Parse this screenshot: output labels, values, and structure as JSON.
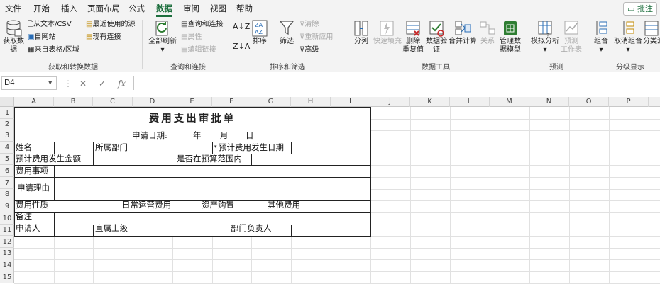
{
  "menu": {
    "tabs": [
      "文件",
      "开始",
      "插入",
      "页面布局",
      "公式",
      "数据",
      "审阅",
      "视图",
      "帮助"
    ],
    "comment_button": "批注"
  },
  "ribbon": {
    "get_transform": {
      "label": "获取和转换数据",
      "get_data": [
        "获取数",
        "据"
      ],
      "from_text_csv": "从文本/CSV",
      "from_web": "自网站",
      "from_table": "来自表格/区域",
      "recent_sources": "最近使用的源",
      "existing_connections": "现有连接"
    },
    "queries": {
      "label": "查询和连接",
      "refresh_all": [
        "全部刷新"
      ],
      "queries_connections": "查询和连接",
      "properties": "属性",
      "edit_links": "编辑链接"
    },
    "sort_filter": {
      "label": "排序和筛选",
      "sort": "排序",
      "filter": "筛选",
      "clear": "清除",
      "reapply": "重新应用",
      "advanced": "高级"
    },
    "data_tools": {
      "label": "数据工具",
      "text_to_columns": "分列",
      "flash_fill": "快速填充",
      "remove_duplicates": [
        "删除",
        "重复值"
      ],
      "data_validation": [
        "数据验",
        "证"
      ],
      "consolidate": "合并计算",
      "relationships": "关系",
      "manage_model": [
        "管理数",
        "据模型"
      ]
    },
    "forecast": {
      "label": "预测",
      "what_if": [
        "模拟分析"
      ],
      "forecast_sheet": [
        "预测",
        "工作表"
      ]
    },
    "outline": {
      "label": "分级显示",
      "group": [
        "组合"
      ],
      "ungroup": [
        "取消组合"
      ],
      "subtotal": "分类汇"
    }
  },
  "formula_bar": {
    "name_box": "D4",
    "cancel_icon": "✕",
    "enter_icon": "✓",
    "fx_icon": "fx",
    "formula": ""
  },
  "columns": [
    "A",
    "B",
    "C",
    "D",
    "E",
    "F",
    "G",
    "H",
    "I",
    "J",
    "K",
    "L",
    "M",
    "N",
    "O",
    "P"
  ],
  "rows": [
    "1",
    "2",
    "3",
    "4",
    "5",
    "6",
    "7",
    "8",
    "9",
    "10",
    "11",
    "12",
    "13",
    "14",
    "15"
  ],
  "form": {
    "title": "费用支出审批单",
    "apply_date": "申请日期:",
    "year": "年",
    "month": "月",
    "day": "日",
    "name": "姓名",
    "department": "所属部门",
    "expected_date": "预计费用发生日期",
    "expected_amount": "预计费用发生金额",
    "in_budget": "是否在预算范围内",
    "item": "费用事项",
    "reason": "申请理由",
    "nature": "费用性质",
    "nature_options": [
      "日常运营费用",
      "资产购置",
      "其他费用"
    ],
    "remark": "备注",
    "applicant": "申请人",
    "supervisor": "直属上级",
    "dept_head": "部门负责人"
  }
}
